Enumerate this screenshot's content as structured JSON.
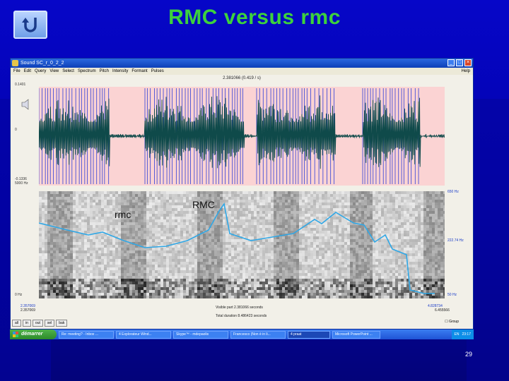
{
  "slide": {
    "title": "RMC versus rmc",
    "page_number": "29",
    "label_lower": "rmc",
    "label_upper": "RMC"
  },
  "window": {
    "title": "Sound SC_r_0_2_2",
    "menu": [
      "File",
      "Edit",
      "Query",
      "View",
      "Select",
      "Spectrum",
      "Pitch",
      "Intensity",
      "Formant",
      "Pulses"
    ],
    "help": "Help",
    "time_top": "2.381066 (0.419 / s)",
    "wave_top": "0.1401",
    "wave_mid": "0",
    "wave_bottom": "-0.1336",
    "spec_top": "5000 Hz",
    "spec_bottom": "0 Hz",
    "right_top": "650 Hz",
    "right_mid": "222.74 Hz",
    "right_bottom": "50 Hz",
    "left_time": "2.357069",
    "left_time2": "2.357069",
    "visible_part": "Visible part 2.381066 seconds",
    "total_duration": "Total duration 8.486423 seconds",
    "right_time": "4.828734",
    "right_time2": "6.455566",
    "nav": [
      "all",
      "in",
      "out",
      "sel",
      "bak"
    ],
    "group": "Group"
  },
  "taskbar": {
    "start": "démarrer",
    "tasks": [
      "Re: meeting? - Inbox ...",
      "4 Explorateur Wind...",
      "Skype™ - mdepaolis",
      "Francesco (Non è in li...",
      "4 praat",
      "Microsoft PowerPoint ..."
    ],
    "tray_lang": "EN",
    "clock": "23:17"
  },
  "colors": {
    "title": "#3dd13d",
    "wave_bg": "#fbd3d3",
    "waveform": "#0f4a4a",
    "pulses": "#2f3fd8",
    "pitch": "#2fa7e6"
  }
}
